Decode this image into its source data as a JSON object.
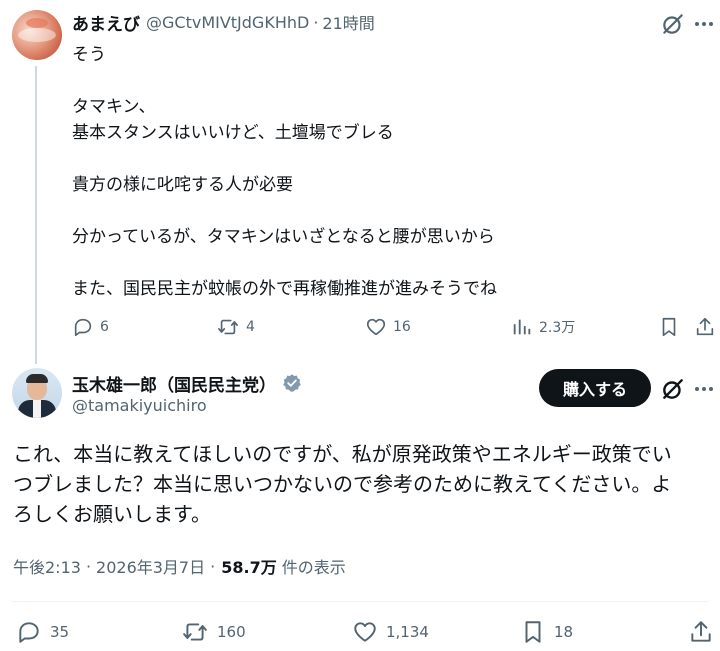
{
  "reply": {
    "display_name": "あまえび",
    "handle": "@GCtvMIVtJdGKHhD",
    "separator": "·",
    "time": "21時間",
    "lines": [
      "そう",
      "",
      "タマキン、",
      "基本スタンスはいいけど、土壇場でブレる",
      "",
      "貴方の様に叱咤する人が必要",
      "",
      "分かっているが、タマキンはいざとなると腰が思いから",
      "",
      "また、国民民主が蚊帳の外で再稼働推進が進みそうでね"
    ],
    "stats": {
      "replies": "6",
      "reposts": "4",
      "likes": "16",
      "views": "2.3万"
    }
  },
  "main": {
    "display_name": "玉木雄一郎（国民民主党）",
    "handle": "@tamakiyuichiro",
    "buy_button": "購入する",
    "text_lines": [
      "これ、本当に教えてほしいのですが、私が原発政策やエネルギー政策でい",
      "つブレました？本当に思いつかないので参考のために教えてください。よ",
      "ろしくお願いします。"
    ],
    "meta": {
      "time": "午後2:13",
      "separator": "·",
      "date": "2026年3月7日",
      "separator2": "·",
      "views": "58.7万",
      "views_label": "件の表示"
    },
    "stats": {
      "replies": "35",
      "reposts": "160",
      "likes": "1,134",
      "bookmarks": "18"
    }
  },
  "icons": {
    "reply": "reply-icon",
    "repost": "repost-icon",
    "like": "heart-icon",
    "views": "analytics-icon",
    "bookmark": "bookmark-icon",
    "share": "share-icon",
    "grok": "grok-icon",
    "more": "more-icon",
    "verified": "verified-badge-icon"
  },
  "colors": {
    "text": "#0f1419",
    "secondary": "#536471",
    "verified_badge": "#829aab",
    "button_bg": "#0f1419"
  }
}
